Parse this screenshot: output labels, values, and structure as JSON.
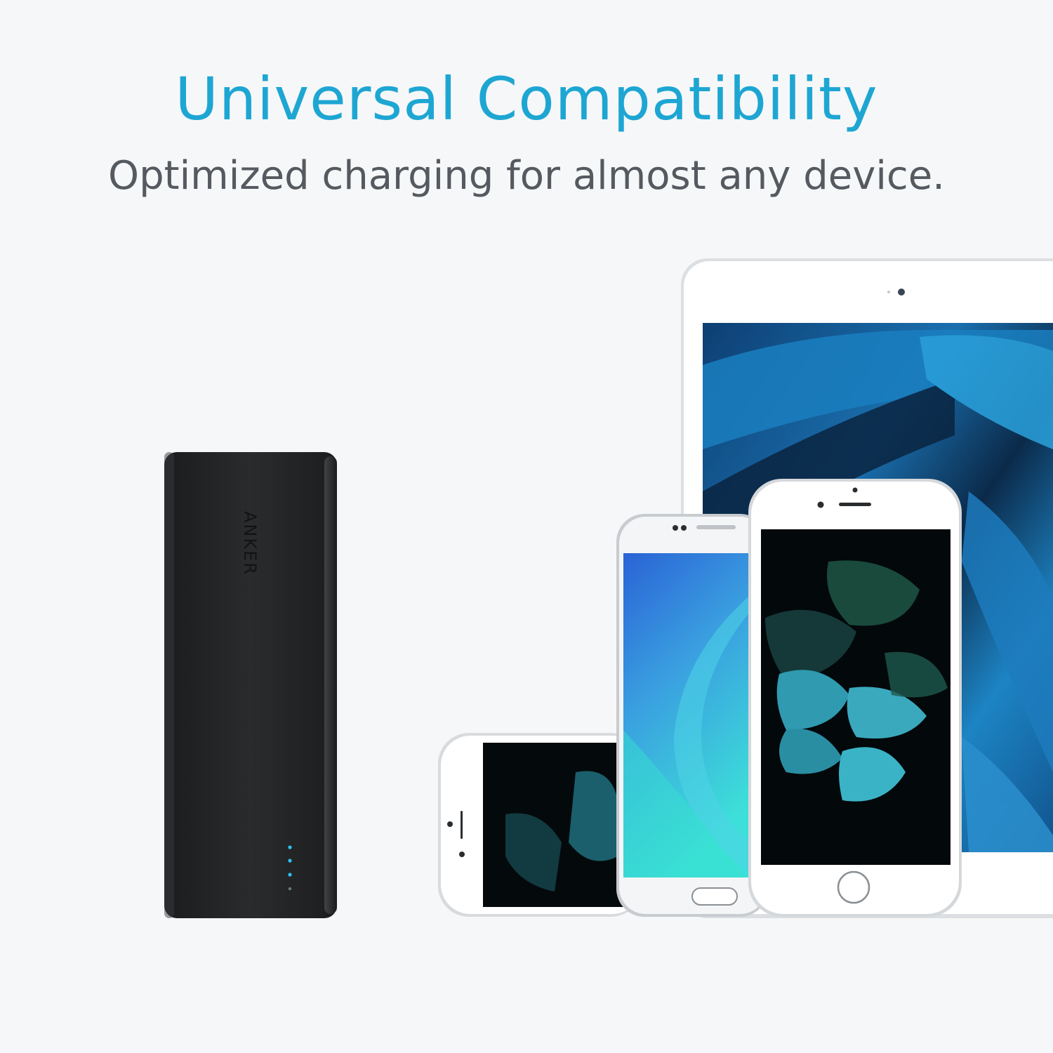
{
  "headline": {
    "text": "Universal Compatibility",
    "color": "#1ea6d3"
  },
  "subline": {
    "text": "Optimized charging for almost any device.",
    "color": "#555a60"
  },
  "powerbank": {
    "brand": "ANKER",
    "led_color": "#2ec1f0",
    "led_count": 4
  },
  "devices": {
    "tablet": "tablet",
    "phone_landscape": "phone",
    "android_phone": "phone",
    "iphone": "phone"
  }
}
